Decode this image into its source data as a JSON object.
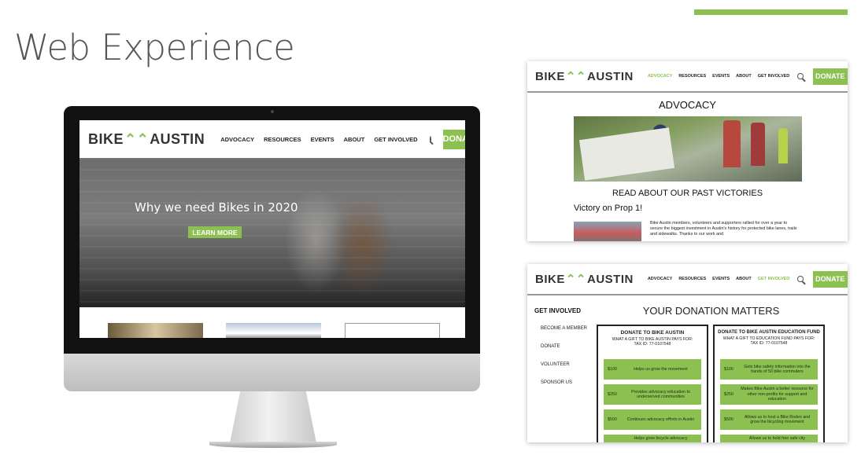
{
  "slide": {
    "title": "Web Experience",
    "accent_color": "#8cc152"
  },
  "brand": {
    "logo_left": "BIKE",
    "logo_right": "AUSTIN",
    "logo_chevron": "⌃⌃"
  },
  "nav": {
    "items": [
      "ADVOCACY",
      "RESOURCES",
      "EVENTS",
      "ABOUT",
      "GET INVOLVED"
    ],
    "donate": "DONATE",
    "search_icon": "search-icon"
  },
  "desktop": {
    "hero_title": "Why we need Bikes in 2020",
    "hero_button": "LEARN MORE"
  },
  "advocacy_page": {
    "active_nav": "ADVOCACY",
    "heading": "ADVOCACY",
    "subheading": "READ ABOUT OUR PAST VICTORIES",
    "victory_title": "Victory on Prop 1!",
    "victory_text": "Bike Austin members, volunteers and supporters rallied for over a year to secure the biggest investment in Austin's history for protected bike lanes, trails and sidewalks. Thanks to our work and"
  },
  "donation_page": {
    "active_nav": "GET INVOLVED",
    "sidebar_title": "GET INVOLVED",
    "sidebar_items": [
      "BECOME A MEMBER",
      "DONATE",
      "VOLUNTEER",
      "SPONSOR US"
    ],
    "heading": "YOUR DONATION MATTERS",
    "columns": [
      {
        "title": "DONATE TO BIKE AUSTIN",
        "sub1": "WHAT A GIFT TO BIKE AUSTIN PAYS FOR:",
        "sub2": "TAX ID: 77-0107548",
        "tiers": [
          {
            "amount": "$100",
            "desc": "Helps us grow the movement"
          },
          {
            "amount": "$250",
            "desc": "Provides advocacy education to underserved communities"
          },
          {
            "amount": "$500",
            "desc": "Continues advocacy efforts in Austin"
          },
          {
            "amount": "",
            "desc": "Helps grow bicycle advocacy"
          }
        ]
      },
      {
        "title": "DONATE TO BIKE AUSTIN EDUCATION FUND",
        "sub1": "WHAT A GIFT TO EDUCATION FUND PAYS FOR:",
        "sub2": "TAX ID: 77-0107548",
        "tiers": [
          {
            "amount": "$100",
            "desc": "Gets bike safety information into the hands of 50 bike commuters"
          },
          {
            "amount": "$250",
            "desc": "Makes Bike Austin a better resource for other non-profits for support and education"
          },
          {
            "amount": "$500",
            "desc": "Allows us to host a Bike Rodeo and grow the bicycling movement"
          },
          {
            "amount": "",
            "desc": "Allows us to hold free safe city"
          }
        ]
      }
    ]
  }
}
